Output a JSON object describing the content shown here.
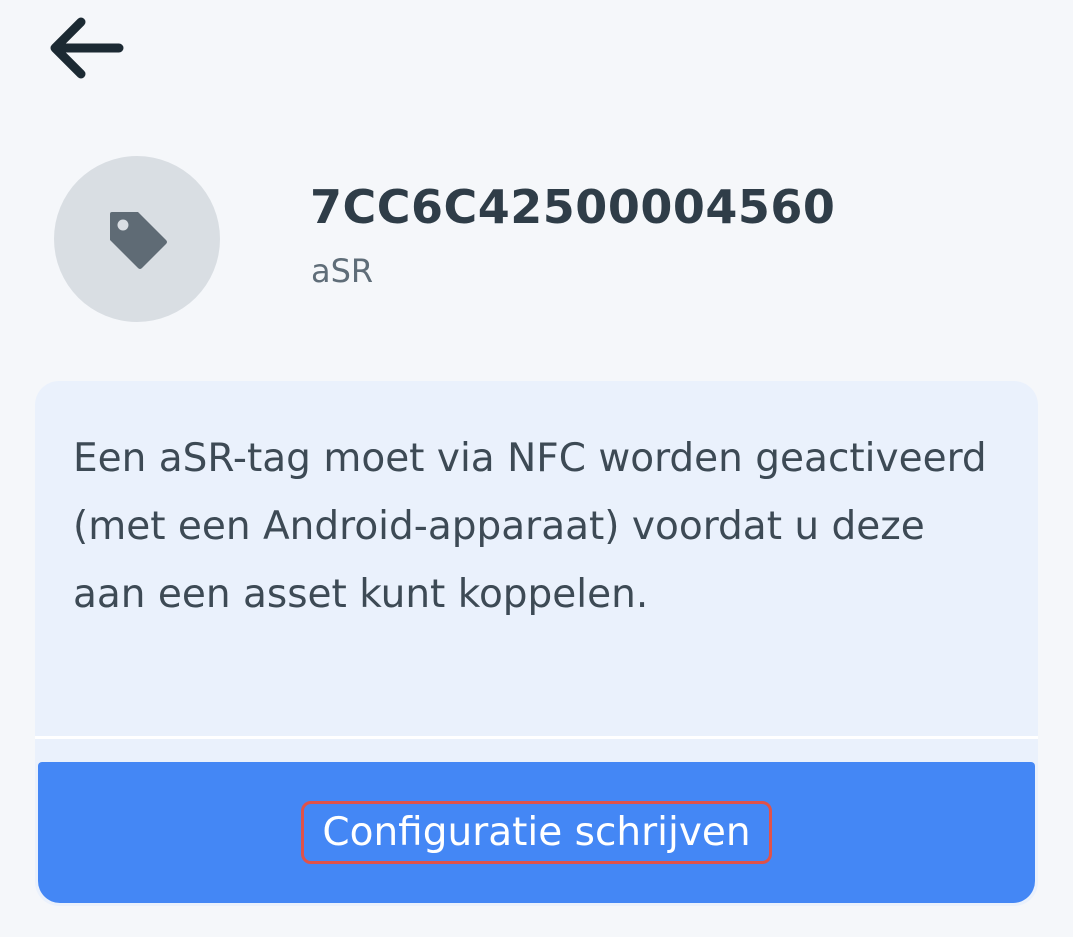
{
  "header": {
    "back_icon": "arrow-left-icon"
  },
  "tag": {
    "icon": "tag-icon",
    "id": "7CC6C42500004560",
    "type": "aSR"
  },
  "info_card": {
    "message": "Een aSR-tag moet via NFC worden geactiveerd (met een Android-apparaat) voordat u deze aan een asset kunt koppelen.",
    "action_label": "Configuratie schrijven"
  },
  "colors": {
    "background": "#f5f7fa",
    "card": "#eaf1fc",
    "primary": "#4487f5",
    "avatar": "#d9dee3",
    "highlight_border": "#e0524a"
  }
}
